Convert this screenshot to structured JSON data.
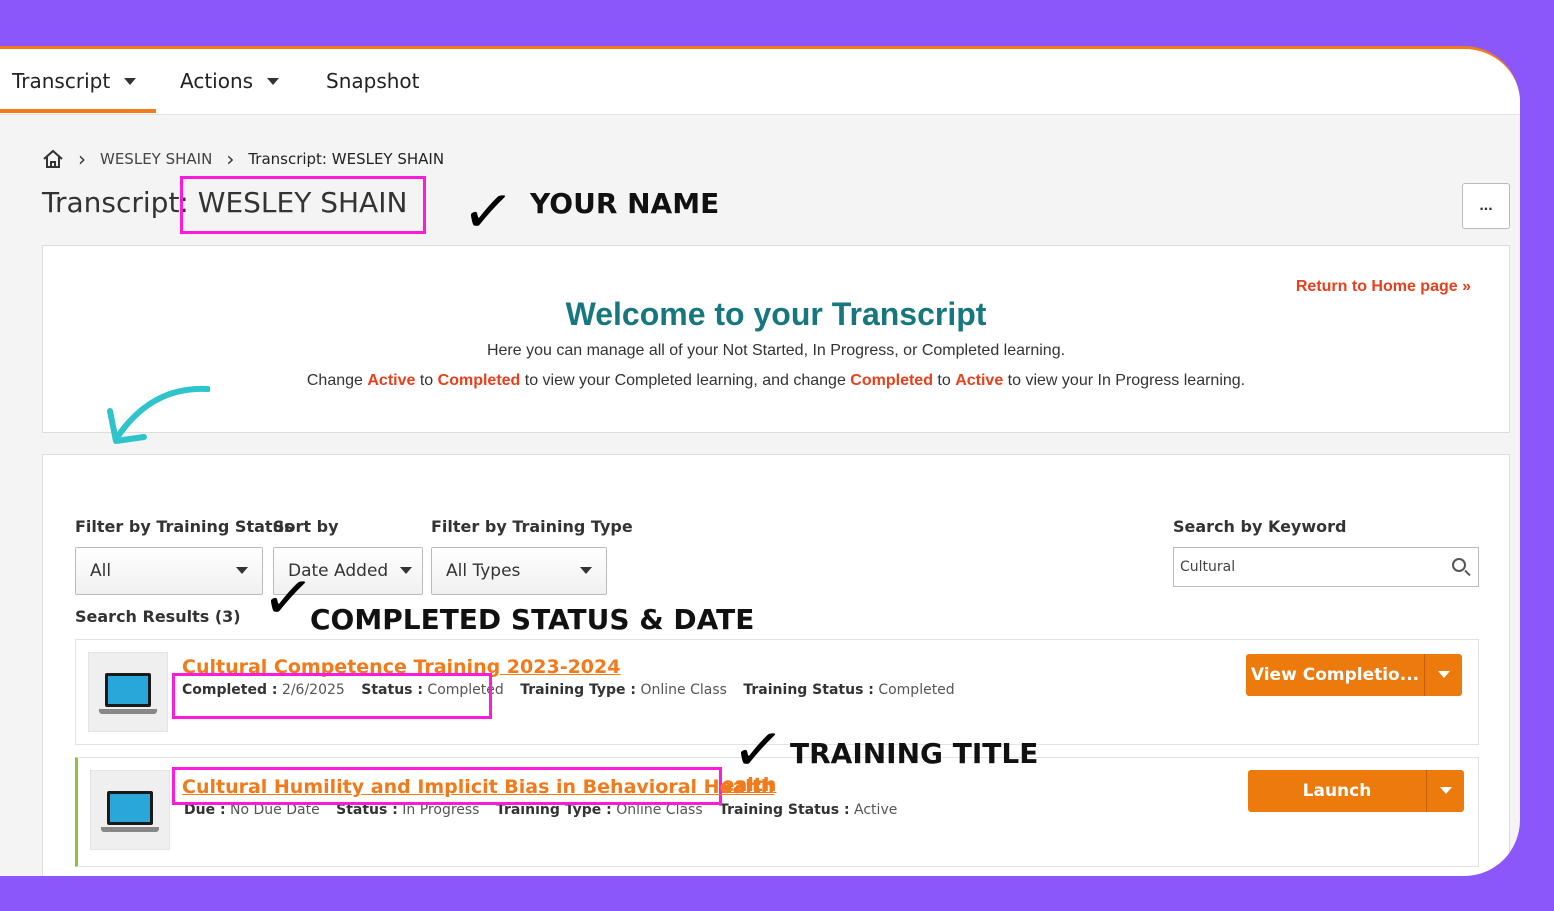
{
  "nav": {
    "tabs": [
      {
        "label": "Transcript",
        "dropdown": true
      },
      {
        "label": "Actions",
        "dropdown": true
      },
      {
        "label": "Snapshot",
        "dropdown": false
      }
    ]
  },
  "breadcrumb": {
    "home_icon": "home-icon",
    "items": [
      "WESLEY SHAIN",
      "Transcript: WESLEY SHAIN"
    ]
  },
  "page": {
    "title_prefix": "Transcript:",
    "title_name": "WESLEY SHAIN",
    "more_label": "..."
  },
  "annotations": {
    "your_name": "YOUR NAME",
    "completed_status": "COMPLETED  STATUS & DATE",
    "training_title": "TRAINING TITLE",
    "check_glyph": "✓"
  },
  "welcome": {
    "return_link": "Return to Home page »",
    "title": "Welcome to your Transcript",
    "subtitle": "Here you can manage all of your Not Started, In Progress, or Completed learning.",
    "line_parts": [
      {
        "text": "Change ",
        "red": false
      },
      {
        "text": "Active",
        "red": true
      },
      {
        "text": " to ",
        "red": false
      },
      {
        "text": "Completed",
        "red": true
      },
      {
        "text": " to view your Completed learning, and change ",
        "red": false
      },
      {
        "text": "Completed",
        "red": true
      },
      {
        "text": " to ",
        "red": false
      },
      {
        "text": "Active",
        "red": true
      },
      {
        "text": " to view your In Progress learning.",
        "red": false
      }
    ]
  },
  "filters": {
    "status_label": "Filter by Training Status",
    "status_value": "All",
    "sort_label": "Sort by",
    "sort_value": "Date Added",
    "type_label": "Filter by Training Type",
    "type_value": "All Types",
    "keyword_label": "Search by Keyword",
    "keyword_value": "Cultural"
  },
  "results": {
    "count_label": "Search Results (3)",
    "items": [
      {
        "title": "Cultural Competence Training 2023-2024",
        "date_label": "Completed :",
        "date_value": "2/6/2025",
        "status_label": "Status :",
        "status_value": "Completed",
        "type_label": "Training Type :",
        "type_value": "Online Class",
        "tstatus_label": "Training Status :",
        "tstatus_value": "Completed",
        "button": "View Completio..."
      },
      {
        "title": "Cultural Humility and Implicit Bias in Behavioral Health",
        "date_label": "Due :",
        "date_value": "No Due Date",
        "status_label": "Status :",
        "status_value": "In Progress",
        "type_label": "Training Type :",
        "type_value": "Online Class",
        "tstatus_label": "Training Status :",
        "tstatus_value": "Active",
        "button": "Launch"
      }
    ]
  },
  "colors": {
    "background": "#8b57fb",
    "accent_orange": "#f27a1a",
    "highlight_pink": "#ff1bd9",
    "welcome_teal": "#17777f",
    "link_red": "#e8401c"
  }
}
